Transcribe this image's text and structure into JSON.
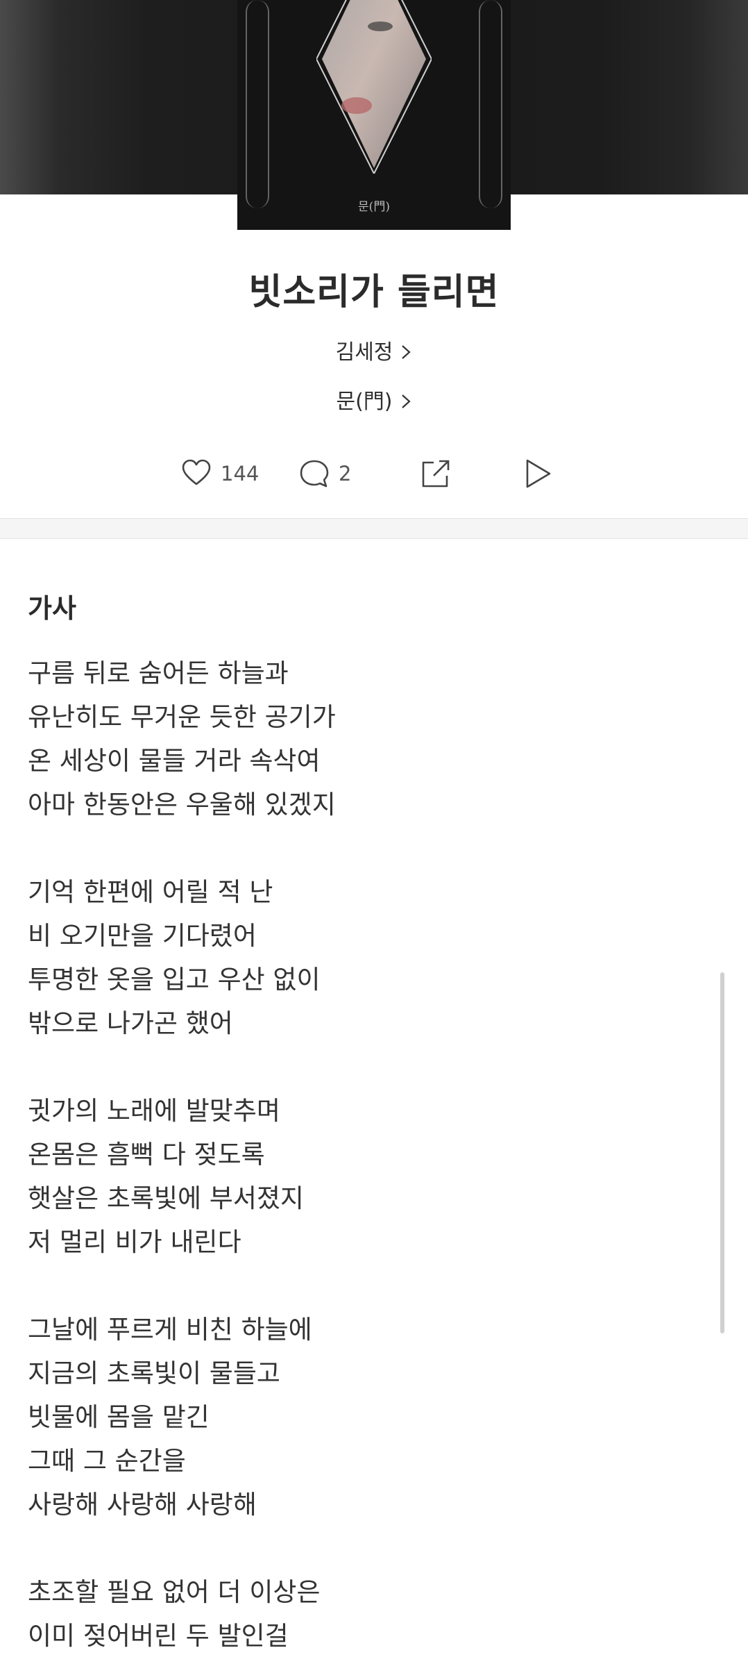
{
  "album": {
    "cover_caption": "문(門)"
  },
  "song": {
    "title": "빗소리가 들리면",
    "artist": "김세정",
    "album_name": "문(門)"
  },
  "actions": {
    "like_count": "144",
    "comment_count": "2",
    "share_icon": "share-icon",
    "play_icon": "play-icon"
  },
  "lyrics": {
    "heading": "가사",
    "lines": [
      "구름 뒤로 숨어든 하늘과",
      "유난히도 무거운 듯한 공기가",
      "온 세상이 물들 거라 속삭여",
      "아마 한동안은 우울해 있겠지",
      "",
      "기억 한편에 어릴 적 난",
      "비 오기만을 기다렸어",
      "투명한 옷을 입고 우산 없이",
      "밖으로 나가곤 했어",
      "",
      "귓가의 노래에 발맞추며",
      "온몸은 흠뻑 다 젖도록",
      "햇살은 초록빛에 부서졌지",
      "저 멀리 비가 내린다",
      "",
      "그날에 푸르게 비친 하늘에",
      "지금의 초록빛이 물들고",
      "빗물에 몸을 맡긴",
      "그때 그 순간을",
      "사랑해 사랑해 사랑해",
      "",
      "초조할 필요 없어 더 이상은",
      "이미 젖어버린 두 발인걸"
    ]
  },
  "colors": {
    "text": "#2b2b2b",
    "secondary": "#555555",
    "band": "#f5f5f5"
  }
}
